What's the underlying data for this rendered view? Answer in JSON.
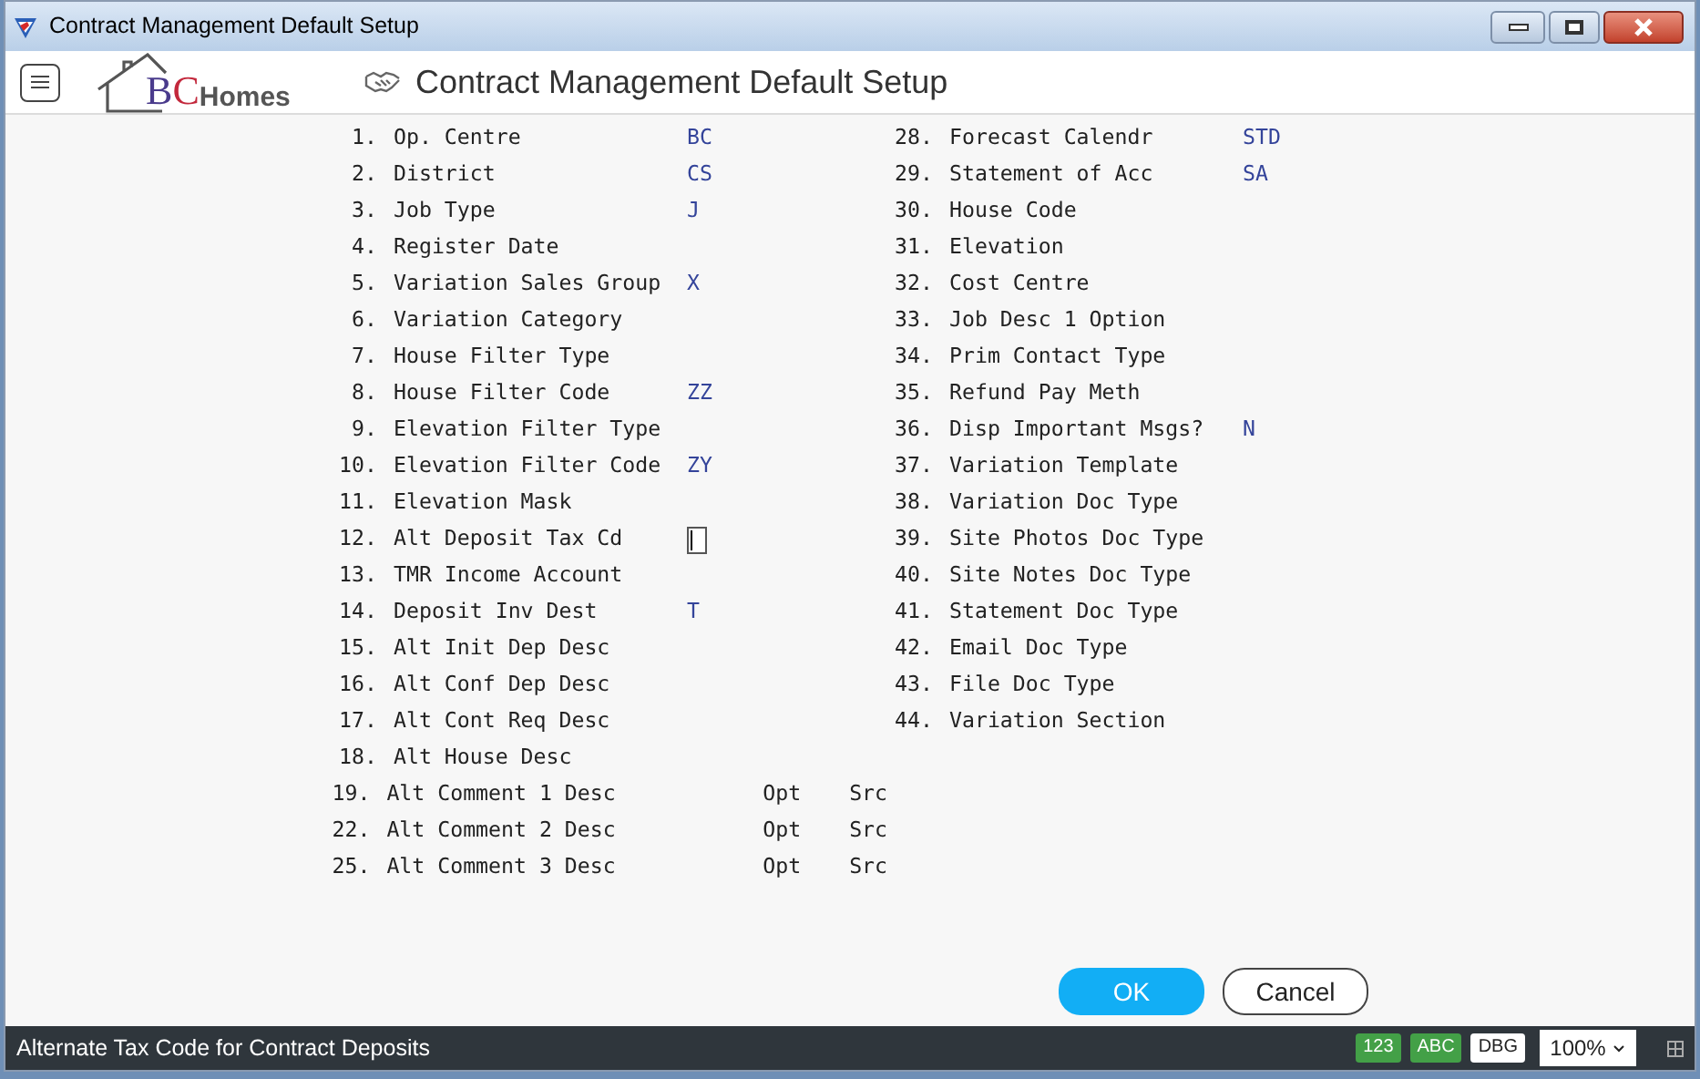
{
  "window": {
    "title": "Contract Management Default Setup"
  },
  "logo": {
    "parts": [
      {
        "text": "B",
        "color": "#4a3b8c"
      },
      {
        "text": "C",
        "color": "#c3283c"
      },
      {
        "text": "Homes",
        "color": "#555555"
      }
    ]
  },
  "header": {
    "title": "Contract Management Default Setup"
  },
  "left_fields": [
    {
      "number": "1.",
      "label": "Op. Centre",
      "kind": "text",
      "value": "BC"
    },
    {
      "number": "2.",
      "label": "District",
      "kind": "text",
      "value": "CS"
    },
    {
      "number": "3.",
      "label": "Job Type",
      "kind": "text",
      "value": "J"
    },
    {
      "number": "4.",
      "label": "Register Date",
      "kind": "text"
    },
    {
      "number": "5.",
      "label": "Variation Sales Group",
      "kind": "text",
      "value": "X"
    },
    {
      "number": "6.",
      "label": "Variation Category",
      "kind": "text"
    },
    {
      "number": "7.",
      "label": "House Filter Type",
      "kind": "text"
    },
    {
      "number": "8.",
      "label": "House Filter Code",
      "kind": "text",
      "value": "ZZ"
    },
    {
      "number": "9.",
      "label": "Elevation Filter Type",
      "kind": "text"
    },
    {
      "number": "10.",
      "label": "Elevation Filter Code",
      "kind": "text",
      "value": "ZY"
    },
    {
      "number": "11.",
      "label": "Elevation Mask",
      "kind": "text"
    },
    {
      "number": "12.",
      "label": "Alt Deposit Tax Cd",
      "kind": "input"
    },
    {
      "number": "13.",
      "label": "TMR Income Account",
      "kind": "text"
    },
    {
      "number": "14.",
      "label": "Deposit Inv Dest",
      "kind": "text",
      "value": "T"
    },
    {
      "number": "15.",
      "label": "Alt Init Dep Desc",
      "kind": "text"
    },
    {
      "number": "16.",
      "label": "Alt Conf Dep Desc",
      "kind": "text"
    },
    {
      "number": "17.",
      "label": "Alt Cont Req Desc",
      "kind": "text"
    },
    {
      "number": "18.",
      "label": "Alt House Desc",
      "kind": "text"
    },
    {
      "number": "19.",
      "label": "Alt Comment 1 Desc",
      "kind": "opt_src",
      "opt": "Opt",
      "src": "Src"
    },
    {
      "number": "22.",
      "label": "Alt Comment 2 Desc",
      "kind": "opt_src",
      "opt": "Opt",
      "src": "Src"
    },
    {
      "number": "25.",
      "label": "Alt Comment 3 Desc",
      "kind": "opt_src",
      "opt": "Opt",
      "src": "Src"
    }
  ],
  "right_fields": [
    {
      "number": "28.",
      "label": "Forecast Calendr",
      "kind": "text",
      "value": "STD"
    },
    {
      "number": "29.",
      "label": "Statement of Acc",
      "kind": "text",
      "value": "SA"
    },
    {
      "number": "30.",
      "label": "House Code",
      "kind": "text"
    },
    {
      "number": "31.",
      "label": "Elevation",
      "kind": "text"
    },
    {
      "number": "32.",
      "label": "Cost Centre",
      "kind": "text"
    },
    {
      "number": "33.",
      "label": "Job Desc 1 Option",
      "kind": "text"
    },
    {
      "number": "34.",
      "label": "Prim Contact Type",
      "kind": "text"
    },
    {
      "number": "35.",
      "label": "Refund Pay Meth",
      "kind": "text"
    },
    {
      "number": "36.",
      "label": "Disp Important Msgs?",
      "kind": "text",
      "value": "N"
    },
    {
      "number": "37.",
      "label": "Variation Template",
      "kind": "text"
    },
    {
      "number": "38.",
      "label": "Variation Doc Type",
      "kind": "text"
    },
    {
      "number": "39.",
      "label": "Site Photos Doc Type",
      "kind": "text"
    },
    {
      "number": "40.",
      "label": "Site Notes Doc Type",
      "kind": "text"
    },
    {
      "number": "41.",
      "label": "Statement Doc Type",
      "kind": "text"
    },
    {
      "number": "42.",
      "label": "Email Doc Type",
      "kind": "text"
    },
    {
      "number": "43.",
      "label": "File Doc Type",
      "kind": "text"
    },
    {
      "number": "44.",
      "label": "Variation Section",
      "kind": "text"
    }
  ],
  "buttons": [
    {
      "label": "OK",
      "kind": "primary"
    },
    {
      "label": "Cancel",
      "kind": "secondary"
    }
  ],
  "status_bar": {
    "message": "Alternate Tax Code for Contract Deposits",
    "badges": [
      {
        "label": "123",
        "color": "#43a047"
      },
      {
        "label": "ABC",
        "color": "#43a047"
      },
      {
        "label": "DBG",
        "color": "#ffffff"
      }
    ],
    "zoom": "100%"
  }
}
